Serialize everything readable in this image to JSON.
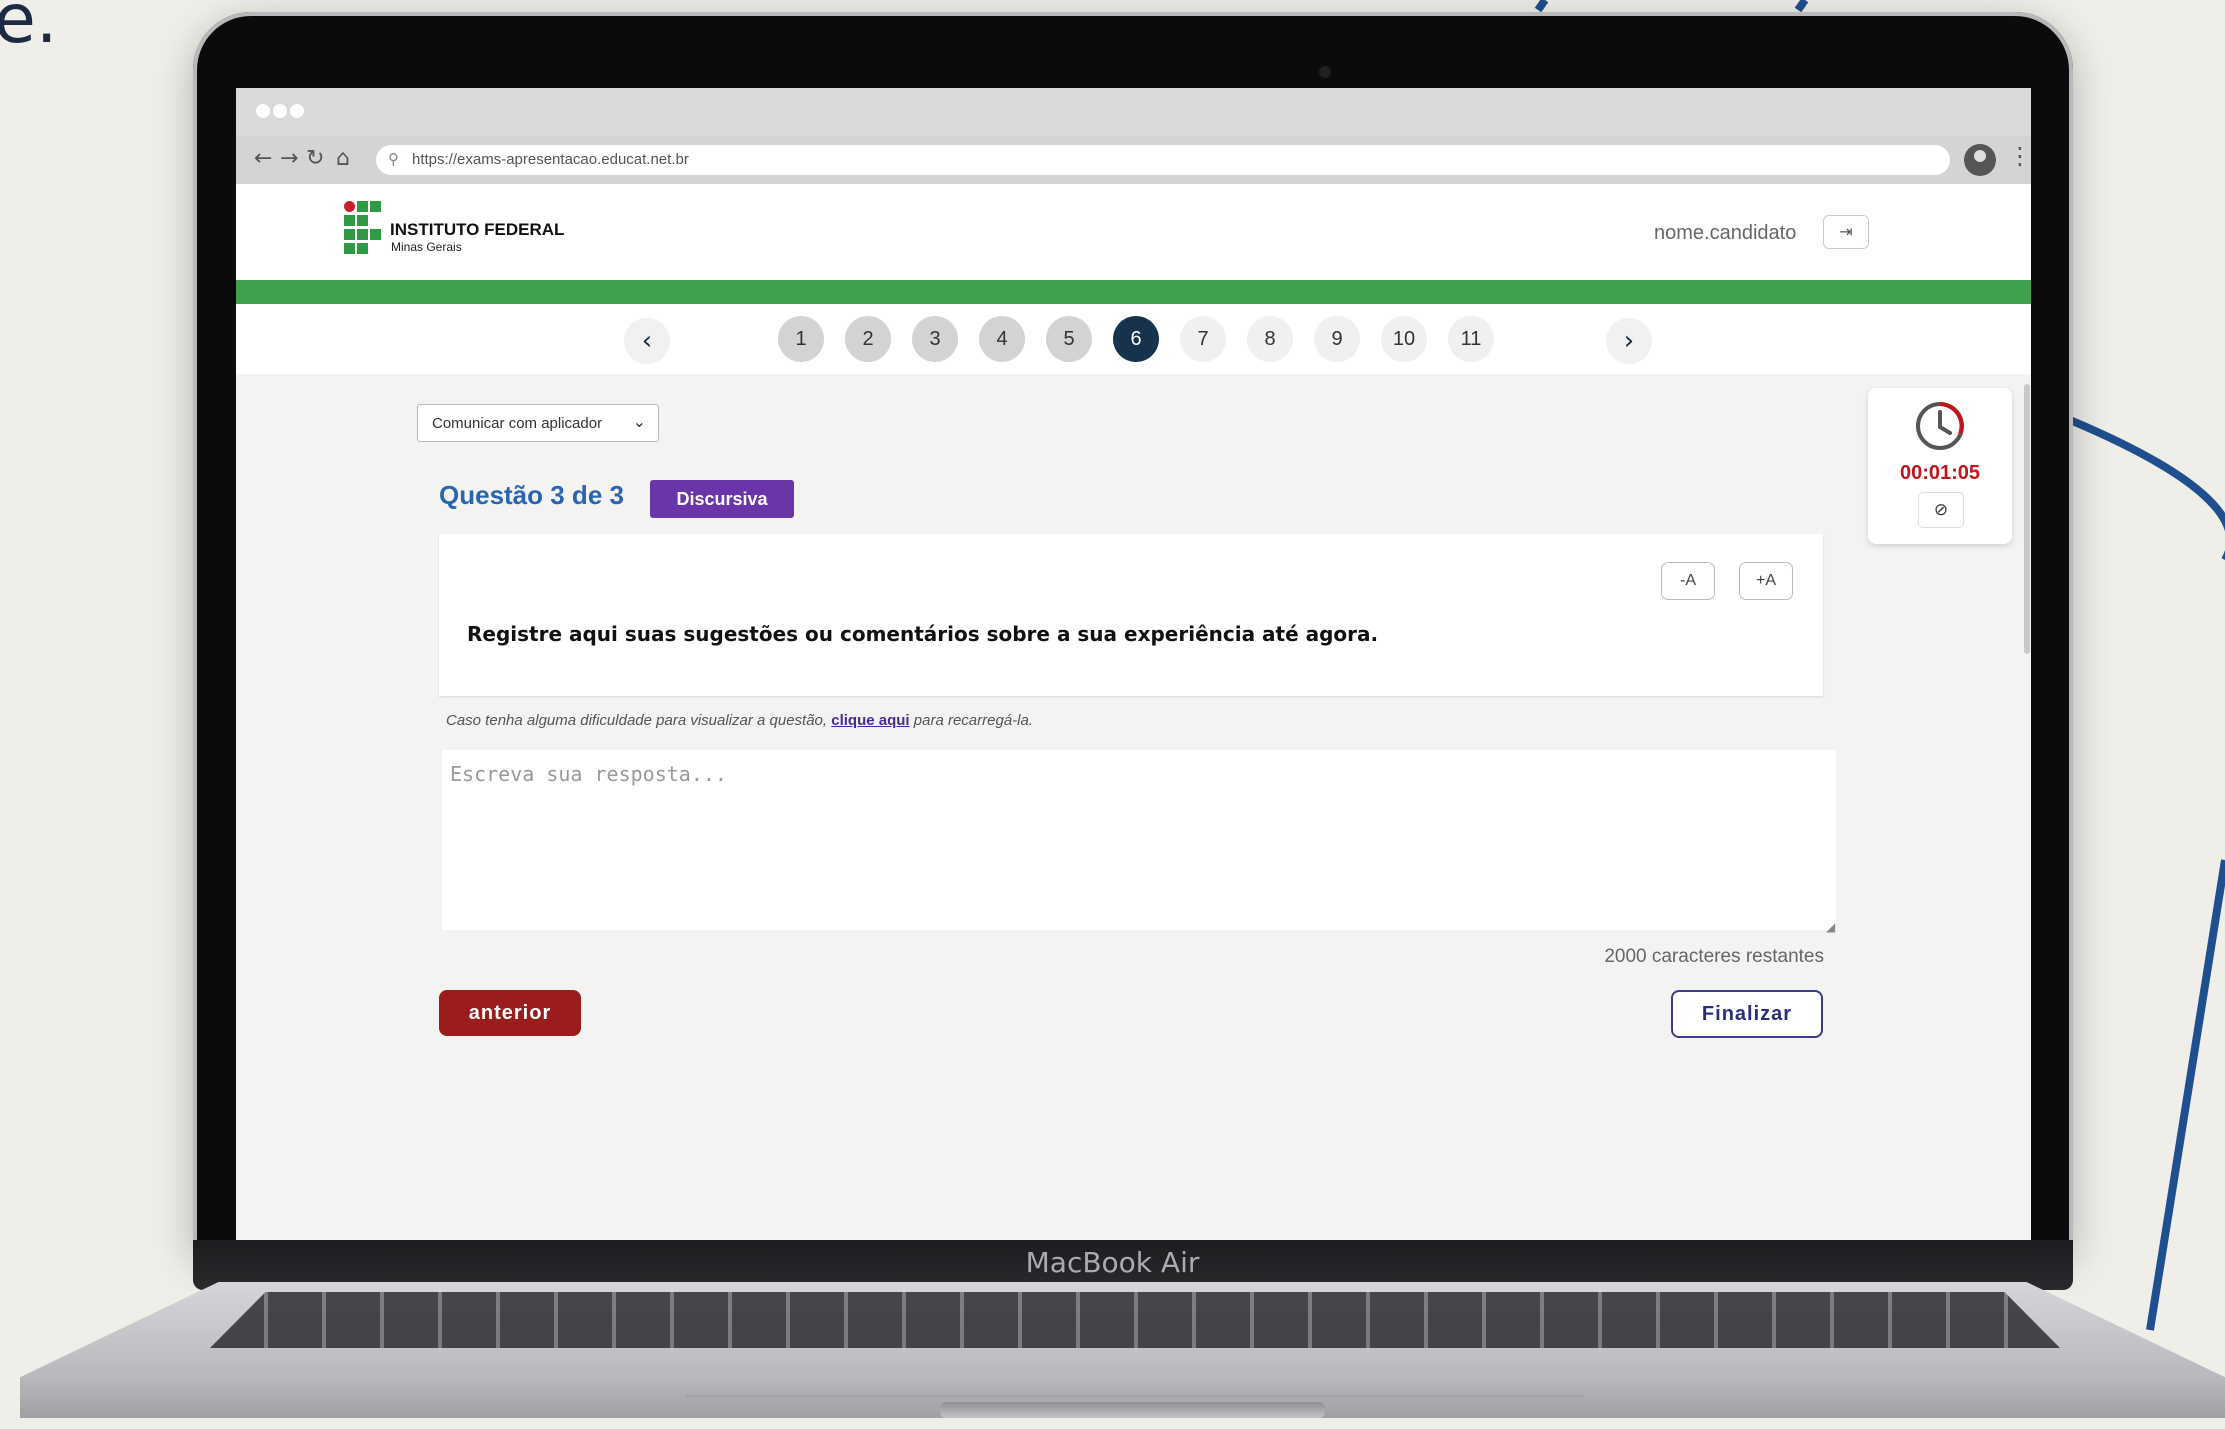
{
  "browser": {
    "url": "https://exams-apresentacao.educat.net.br"
  },
  "device": {
    "label": "MacBook Air"
  },
  "header": {
    "institution_title": "INSTITUTO FEDERAL",
    "institution_subtitle": "Minas Gerais",
    "username": "nome.candidato"
  },
  "pager": {
    "prev_icon": "chevron-left-icon",
    "next_icon": "chevron-right-icon",
    "pages": [
      {
        "label": "1",
        "state": "done"
      },
      {
        "label": "2",
        "state": "done"
      },
      {
        "label": "3",
        "state": "done"
      },
      {
        "label": "4",
        "state": "done"
      },
      {
        "label": "5",
        "state": "done"
      },
      {
        "label": "6",
        "state": "current"
      },
      {
        "label": "7",
        "state": "todo"
      },
      {
        "label": "8",
        "state": "todo"
      },
      {
        "label": "9",
        "state": "todo"
      },
      {
        "label": "10",
        "state": "todo"
      },
      {
        "label": "11",
        "state": "todo"
      }
    ]
  },
  "communicate": {
    "label": "Comunicar com aplicador"
  },
  "question": {
    "title": "Questão 3 de 3",
    "type_badge": "Discursiva",
    "font_decrease": "-A",
    "font_increase": "+A",
    "text": "Registre aqui suas sugestões ou comentários sobre a sua experiência até agora."
  },
  "hint": {
    "before": "Caso tenha alguma dificuldade para visualizar a questão, ",
    "link": "clique aqui",
    "after": " para recarregá-la."
  },
  "answer": {
    "placeholder": "Escreva sua resposta...",
    "chars_remaining": "2000 caracteres restantes"
  },
  "actions": {
    "previous": "anterior",
    "finish": "Finalizar"
  },
  "timer": {
    "time": "00:01:05"
  },
  "colors": {
    "brand_green": "#3fa34d",
    "question_blue": "#2a66b0",
    "badge_purple": "#6a35a8",
    "current_page": "#17324d",
    "prev_button": "#9b1c1c",
    "timer_red": "#c0151b"
  }
}
